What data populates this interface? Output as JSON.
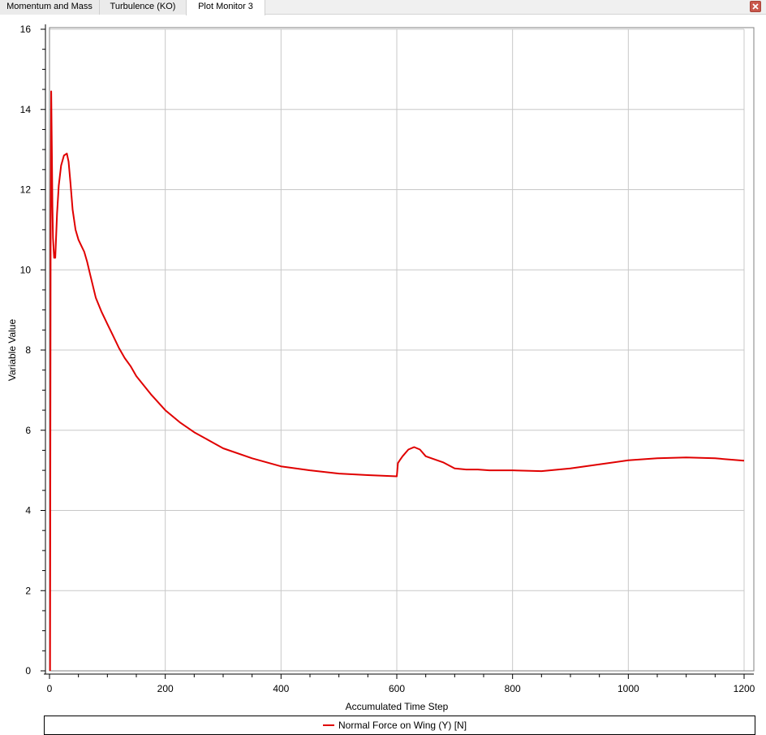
{
  "tabs": [
    {
      "label": "Momentum and Mass",
      "active": false
    },
    {
      "label": "Turbulence (KO)",
      "active": false
    },
    {
      "label": "Plot Monitor 3",
      "active": true
    }
  ],
  "close_icon": "close-icon",
  "colors": {
    "series": "#e00000",
    "grid": "#c8c8c8",
    "close_button": "#c9574b"
  },
  "chart_data": {
    "type": "line",
    "title": "",
    "xlabel": "Accumulated Time Step",
    "ylabel": "Variable Value",
    "xlim": [
      0,
      1200
    ],
    "ylim": [
      0,
      16
    ],
    "xticks": [
      0,
      200,
      400,
      600,
      800,
      1000,
      1200
    ],
    "yticks": [
      0,
      2,
      4,
      6,
      8,
      10,
      12,
      14,
      16
    ],
    "grid": true,
    "legend_position": "bottom",
    "series": [
      {
        "name": "Normal Force on Wing (Y) [N]",
        "color": "#e00000",
        "x": [
          1,
          2,
          3,
          4,
          5,
          6,
          8,
          10,
          13,
          16,
          20,
          25,
          30,
          33,
          36,
          40,
          45,
          50,
          55,
          60,
          65,
          70,
          80,
          90,
          100,
          110,
          120,
          130,
          140,
          150,
          175,
          200,
          225,
          250,
          275,
          300,
          350,
          400,
          450,
          500,
          550,
          600,
          602,
          605,
          610,
          620,
          630,
          640,
          650,
          660,
          680,
          700,
          720,
          740,
          760,
          800,
          850,
          900,
          950,
          1000,
          1050,
          1100,
          1150,
          1200
        ],
        "y": [
          0,
          10.6,
          14.45,
          13.0,
          11.6,
          10.8,
          10.3,
          10.3,
          11.4,
          12.1,
          12.6,
          12.85,
          12.9,
          12.7,
          12.2,
          11.5,
          11.0,
          10.75,
          10.6,
          10.45,
          10.2,
          9.9,
          9.3,
          8.95,
          8.65,
          8.35,
          8.05,
          7.8,
          7.6,
          7.35,
          6.9,
          6.5,
          6.2,
          5.95,
          5.75,
          5.55,
          5.3,
          5.1,
          5.0,
          4.92,
          4.88,
          4.85,
          5.18,
          5.25,
          5.35,
          5.52,
          5.58,
          5.52,
          5.35,
          5.3,
          5.2,
          5.05,
          5.02,
          5.02,
          5.0,
          5.0,
          4.98,
          5.05,
          5.15,
          5.25,
          5.3,
          5.32,
          5.3,
          5.24
        ]
      }
    ]
  }
}
